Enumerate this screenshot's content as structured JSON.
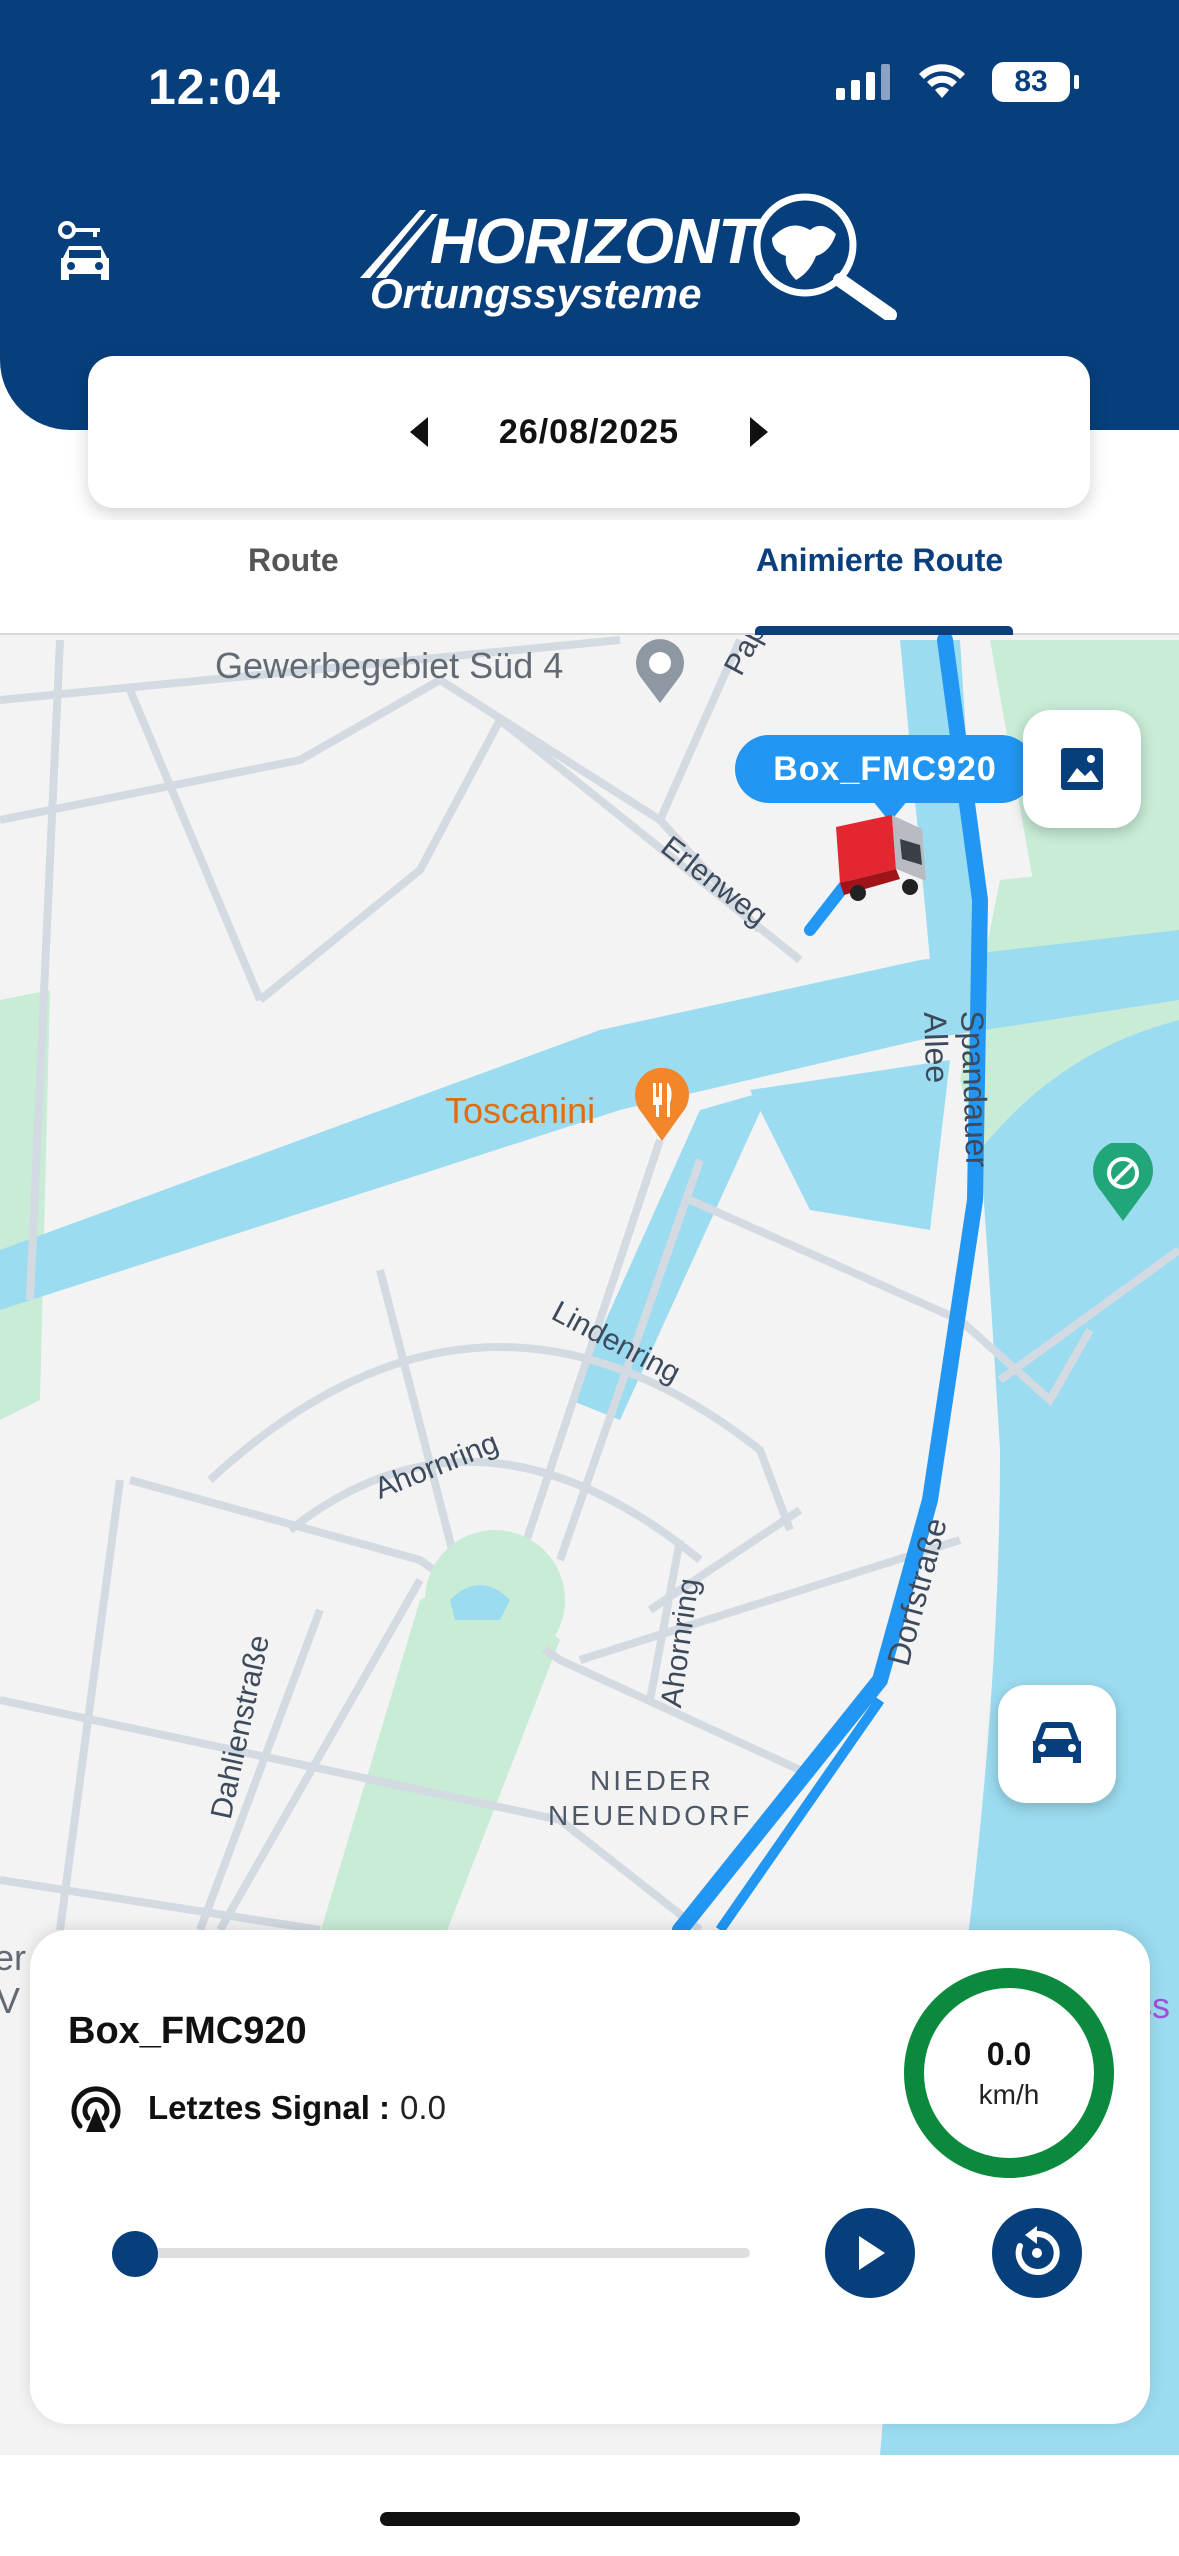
{
  "status_bar": {
    "time": "12:04",
    "battery": "83"
  },
  "header": {
    "logo_title": "HORIZONT",
    "logo_subtitle": "Ortungssysteme"
  },
  "date_picker": {
    "date": "26/08/2025"
  },
  "tabs": [
    {
      "label": "Route",
      "active": false
    },
    {
      "label": "Animierte Route",
      "active": true
    }
  ],
  "map": {
    "places": {
      "gewerbegebiet": "Gewerbegebiet Süd 4",
      "toscanini": "Toscanini",
      "aussicht": "Auss",
      "partial_left_1": "er",
      "partial_left_2": "V"
    },
    "streets": {
      "pappel": "Pappel",
      "erlenweg": "Erlenweg",
      "spandauer_allee": "Spandauer Allee",
      "lindenring": "Lindenring",
      "ahornring_1": "Ahornring",
      "ahornring_2": "Ahornring",
      "dorfstrasse": "Dorfstraße",
      "dahlienstrasse": "Dahlienstraße",
      "district_1": "NIEDER",
      "district_2": "NEUENDORF"
    },
    "vehicle_label": "Box_FMC920"
  },
  "panel": {
    "vehicle_name": "Box_FMC920",
    "signal_label": "Letztes Signal :",
    "signal_value": "0.0",
    "speed_value": "0.0",
    "speed_unit": "km/h",
    "progress": 0
  },
  "colors": {
    "brand": "#073f7c",
    "route": "#2196f3",
    "speed_ring": "#0b8a3e",
    "water": "#9cdcf0",
    "park": "#c8ecd6"
  }
}
